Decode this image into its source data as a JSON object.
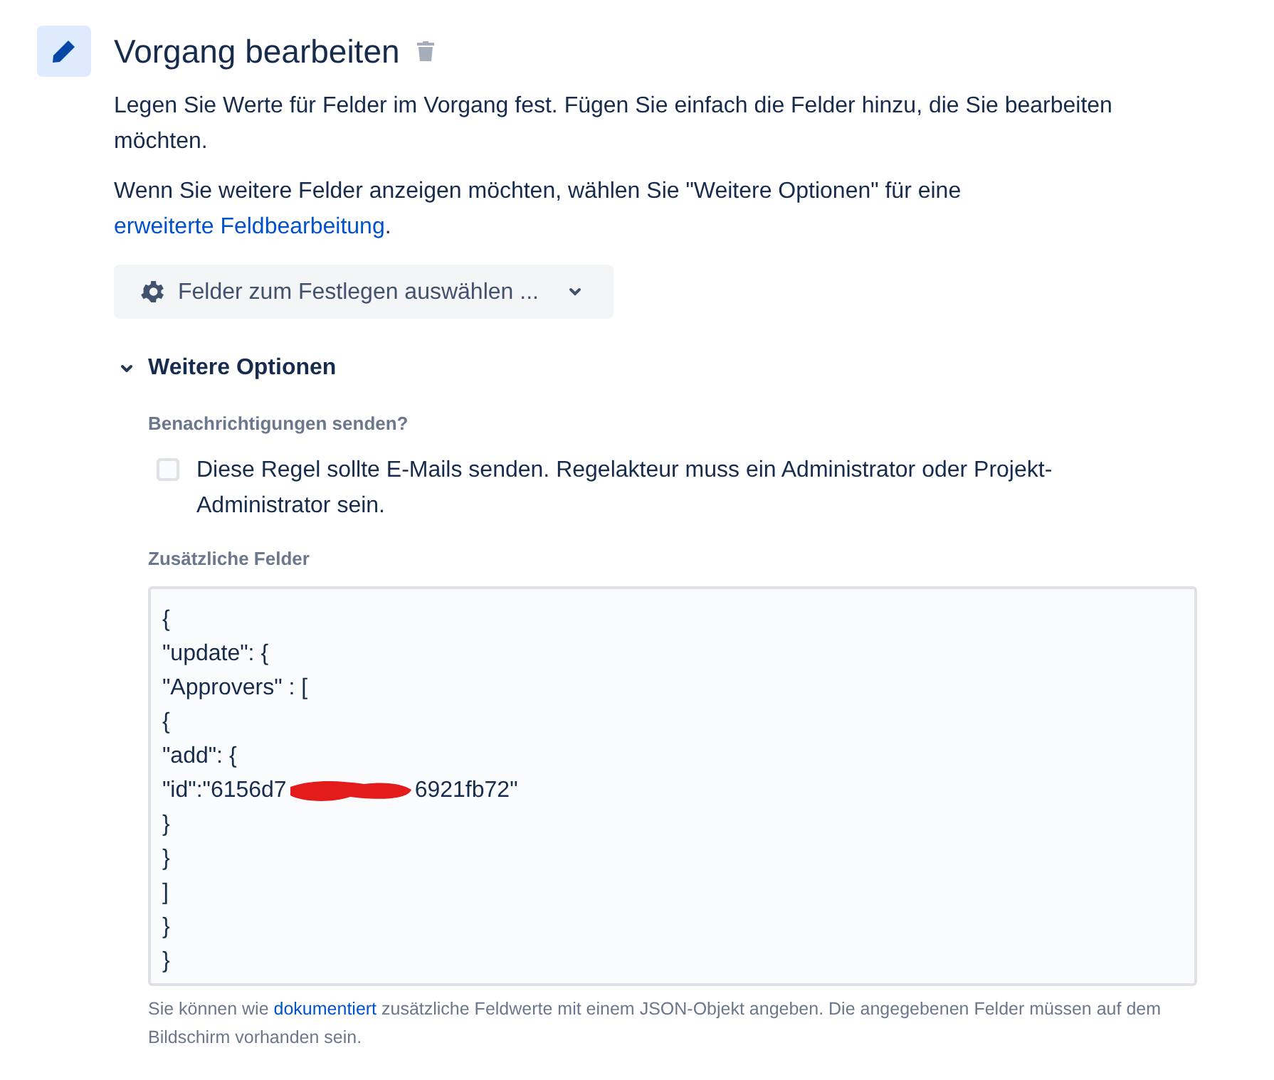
{
  "header": {
    "title": "Vorgang bearbeiten"
  },
  "intro": "Legen Sie Werte für Felder im Vorgang fest. Fügen Sie einfach die Felder hinzu, die Sie bearbeiten möchten.",
  "more_info": {
    "before": "Wenn Sie weitere Felder anzeigen möchten, wählen Sie \"Weitere Optionen\" für eine ",
    "link": "erweiterte Feldbearbeitung",
    "after": "."
  },
  "field_picker": {
    "label": "Felder zum Festlegen auswählen ..."
  },
  "more_options": {
    "label": "Weitere Optionen",
    "expanded": true,
    "notify": {
      "label": "Benachrichtigungen senden?",
      "checkbox": {
        "label": "Diese Regel sollte E-Mails senden. Regelakteur muss ein Administrator oder Projekt-Administrator sein.",
        "checked": false
      }
    },
    "additional_fields": {
      "label": "Zusätzliche Felder",
      "lines": [
        {
          "text": "{"
        },
        {
          "text": "\"update\": {"
        },
        {
          "text": "\"Approvers\" : ["
        },
        {
          "text": "{"
        },
        {
          "text": "\"add\": {"
        },
        {
          "text": "\"id\":\"6156d7",
          "redacted_after": "6921fb72\""
        },
        {
          "text": "}"
        },
        {
          "text": "}"
        },
        {
          "text": "]"
        },
        {
          "text": "}"
        },
        {
          "text": "}"
        }
      ],
      "help": {
        "before": "Sie können wie ",
        "link": "dokumentiert",
        "after": " zusätzliche Feldwerte mit einem JSON-Objekt angeben. Die angegebenen Felder müssen auf dem Bildschirm vorhanden sein."
      }
    }
  }
}
